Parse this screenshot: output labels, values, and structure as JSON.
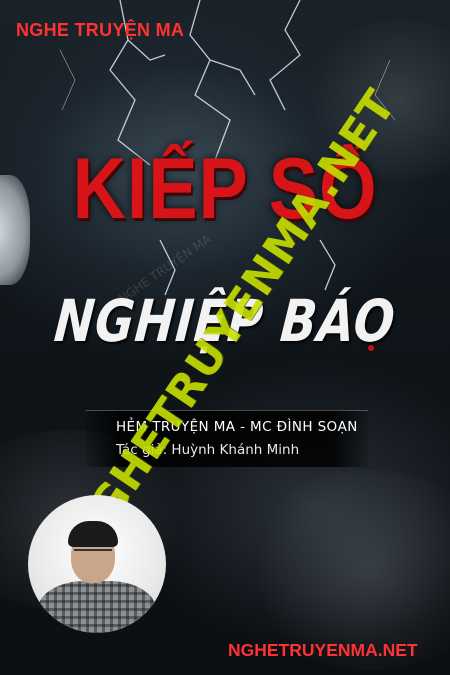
{
  "cover": {
    "channel_name": "NGHE TRUYỆN MA",
    "title_line_1": "KIẾP SỐ",
    "title_line_2": "NGHIỆP BÁO",
    "narrator_line": "HẺM TRUYỆN MA - MC ĐÌNH SOẠN",
    "author_line": "Tác giả: Huỳnh Khánh Minh",
    "watermark_text": "NGHETRUYENMA.NET",
    "website": "NGHETRUYENMA.NET",
    "colors": {
      "accent_red": "#ff3232",
      "title_red": "#d71418",
      "watermark_green": "#c8e000",
      "background": "#0b0e12"
    },
    "avatar_icon": "narrator-portrait"
  }
}
